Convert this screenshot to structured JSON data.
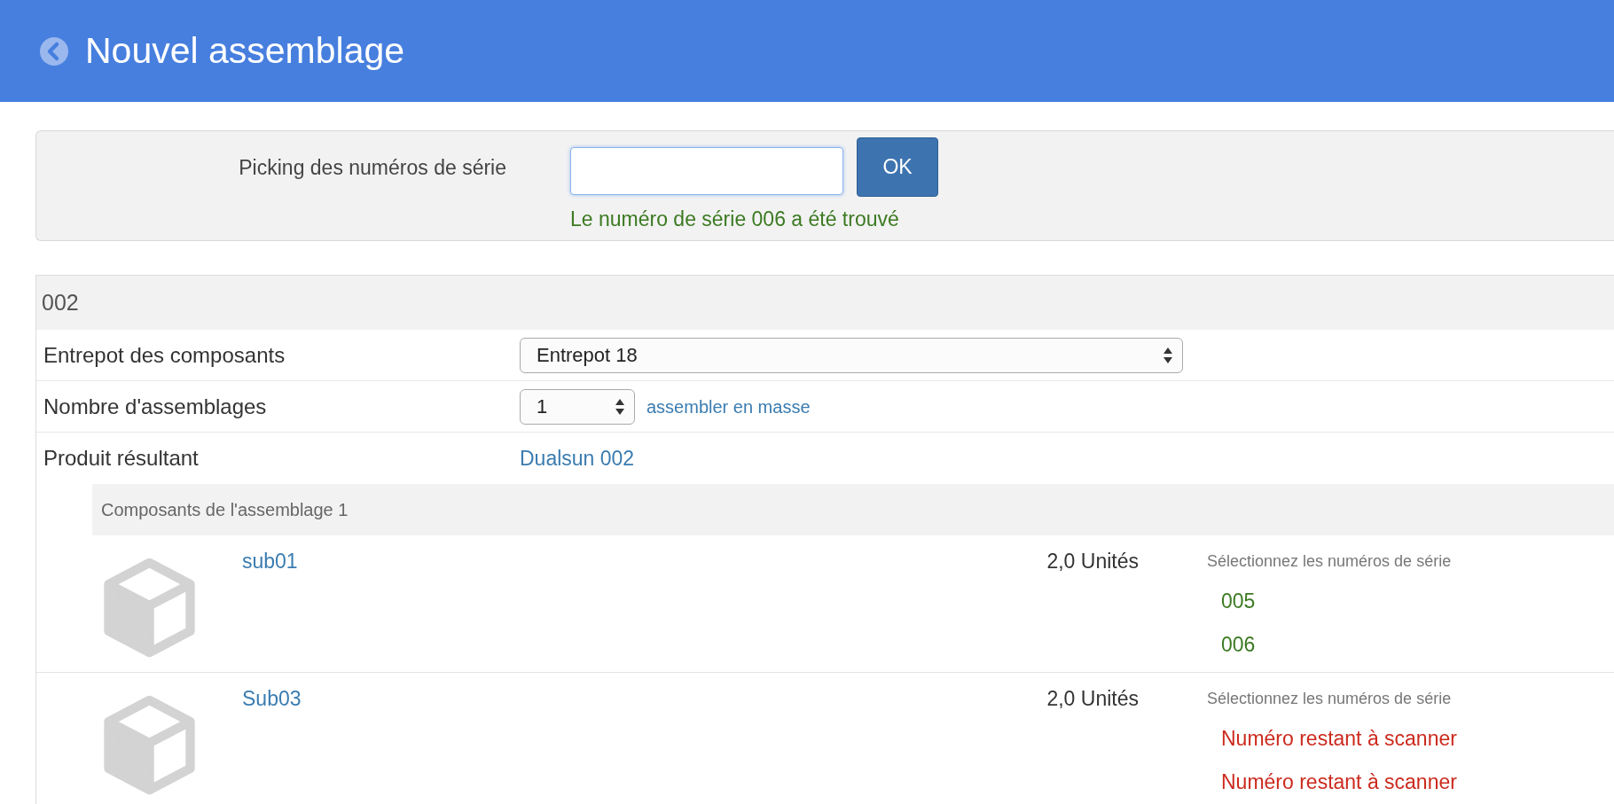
{
  "header": {
    "title": "Nouvel assemblage"
  },
  "picking": {
    "label": "Picking des numéros de série",
    "button": "OK",
    "message": "Le numéro de série 006 a été trouvé"
  },
  "assembly": {
    "title": "002",
    "fields": [
      {
        "kind": "select",
        "label": "Entrepot des composants",
        "value": "Entrepot 18"
      },
      {
        "kind": "number",
        "label": "Nombre d'assemblages",
        "value": "1",
        "link": "assembler en masse"
      },
      {
        "kind": "link",
        "label": "Produit résultant",
        "value": "Dualsun 002"
      }
    ],
    "components_title": "Composants de l'assemblage 1",
    "components": [
      {
        "name": "sub01",
        "quantity": "2,0 Unités",
        "serials_label": "Sélectionnez les numéros de série",
        "serials": [
          {
            "text": "005",
            "color": "#3c7a22"
          },
          {
            "text": "006",
            "color": "#3c7a22"
          }
        ]
      },
      {
        "name": "Sub03",
        "quantity": "2,0 Unités",
        "serials_label": "Sélectionnez les numéros de série",
        "serials": [
          {
            "text": "Numéro restant à scanner",
            "color": "#cc2a1e"
          },
          {
            "text": "Numéro restant à scanner",
            "color": "#cc2a1e"
          }
        ]
      }
    ]
  }
}
